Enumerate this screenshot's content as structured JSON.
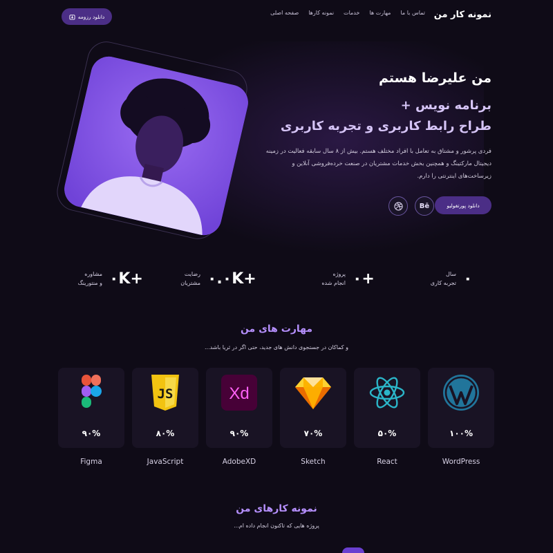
{
  "nav": {
    "brand": "نمونه کار من",
    "items": [
      "صفحه اصلی",
      "نمونه کارها",
      "خدمات",
      "مهارت ها",
      "تماس با ما"
    ],
    "resume_button": "دانلود رزومه"
  },
  "hero": {
    "title": "من علیرضا هستم",
    "subtitle_line1": "برنامه نویس +",
    "subtitle_line2": "طراح رابط کاربری و تجربه کاربری",
    "description": "فردی پرشور و مشتاق به تعامل با افراد مختلف هستم. بیش از ۸ سال سابقه فعالیت در زمینه دیجیتال مارکتینگ و همچنین بخش خدمات مشتریان در صنعت خرده‌فروشی آنلاین و زیرساخت‌های اینترنتی را دارم.",
    "portfolio_button": "دانلود پورتفولیو",
    "behance_label": "Bē"
  },
  "stats": [
    {
      "value": "۰",
      "label1": "سال",
      "label2": "تجربه کاری"
    },
    {
      "value": "۰+",
      "label1": "پروژه",
      "label2": "انجام شده"
    },
    {
      "value": "۰.۰K+",
      "label1": "رضایت",
      "label2": "مشتریان"
    },
    {
      "value": "۰K+",
      "label1": "مشاوره",
      "label2": "و منتورینگ"
    }
  ],
  "skills_section": {
    "title": "مهارت های من",
    "subtitle": "و کماکان در جستجوی دانش های جدید، حتی اگر در ثریا باشد...",
    "skills": [
      {
        "name": "WordPress",
        "percent": "۱۰۰%",
        "icon": "wordpress-icon"
      },
      {
        "name": "React",
        "percent": "۵۰%",
        "icon": "react-icon"
      },
      {
        "name": "Sketch",
        "percent": "۷۰%",
        "icon": "sketch-icon"
      },
      {
        "name": "AdobeXD",
        "percent": "۹۰%",
        "icon": "adobexd-icon",
        "icon_text": "Xd"
      },
      {
        "name": "JavaScript",
        "percent": "۸۰%",
        "icon": "javascript-icon",
        "icon_text": "JS"
      },
      {
        "name": "Figma",
        "percent": "۹۰%",
        "icon": "figma-icon"
      }
    ]
  },
  "portfolio_section": {
    "title": "نمونه کارهای من",
    "subtitle": "پروژه هایی که تاکنون انجام داده ام..."
  },
  "colors": {
    "background": "#0f0b17",
    "accent": "#4b2e86",
    "heading_purple": "#b690ff",
    "card": "#191324"
  }
}
